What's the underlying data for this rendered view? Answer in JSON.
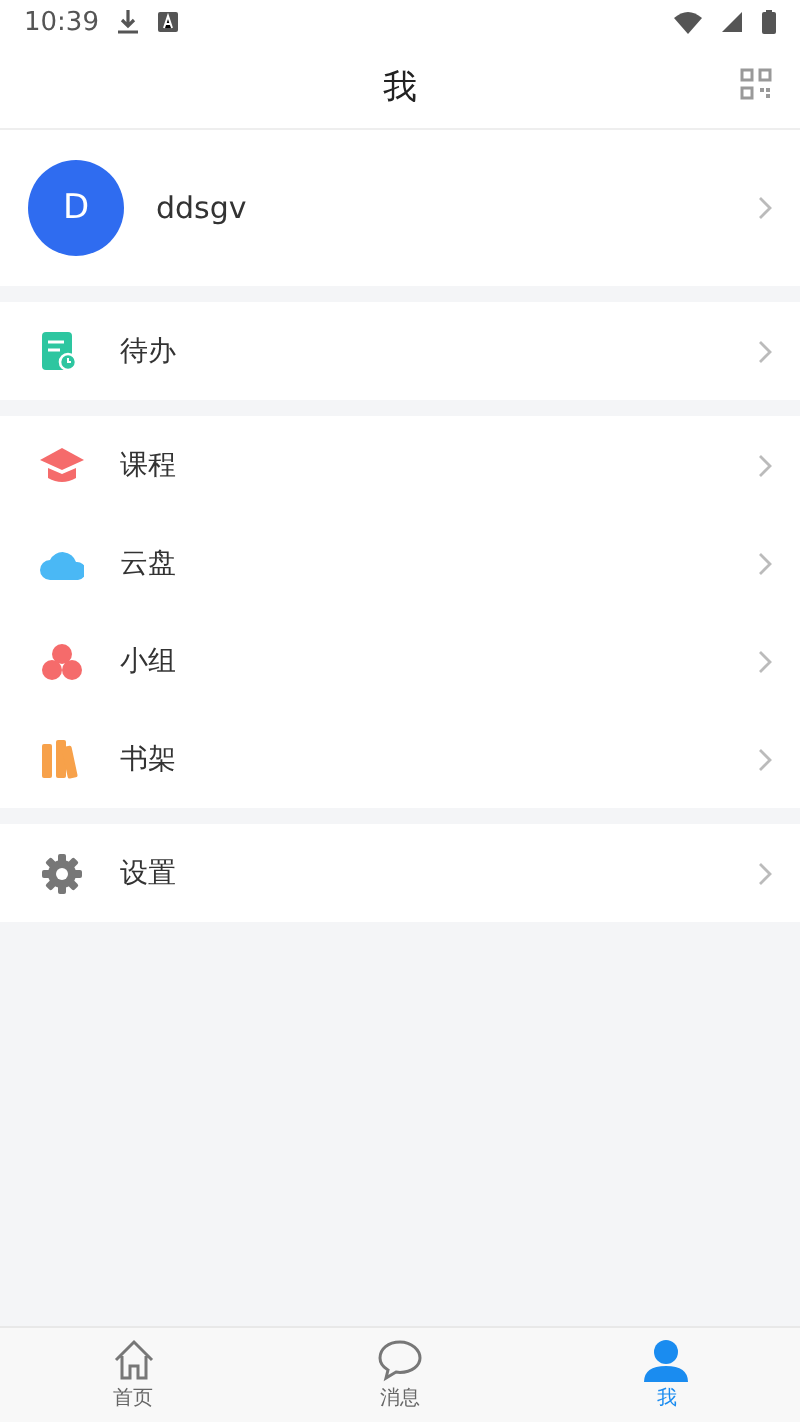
{
  "status_bar": {
    "time": "10:39"
  },
  "header": {
    "title": "我"
  },
  "profile": {
    "avatar_letter": "D",
    "name": "ddsgv"
  },
  "menu_groups": [
    [
      {
        "kind": "todo",
        "label": "待办"
      }
    ],
    [
      {
        "kind": "course",
        "label": "课程"
      },
      {
        "kind": "cloud",
        "label": "云盘"
      },
      {
        "kind": "group",
        "label": "小组"
      },
      {
        "kind": "bookshelf",
        "label": "书架"
      }
    ],
    [
      {
        "kind": "settings",
        "label": "设置"
      }
    ]
  ],
  "tab_bar": [
    {
      "kind": "home",
      "label": "首页",
      "selected": false
    },
    {
      "kind": "message",
      "label": "消息",
      "selected": false
    },
    {
      "kind": "me",
      "label": "我",
      "selected": true
    }
  ]
}
